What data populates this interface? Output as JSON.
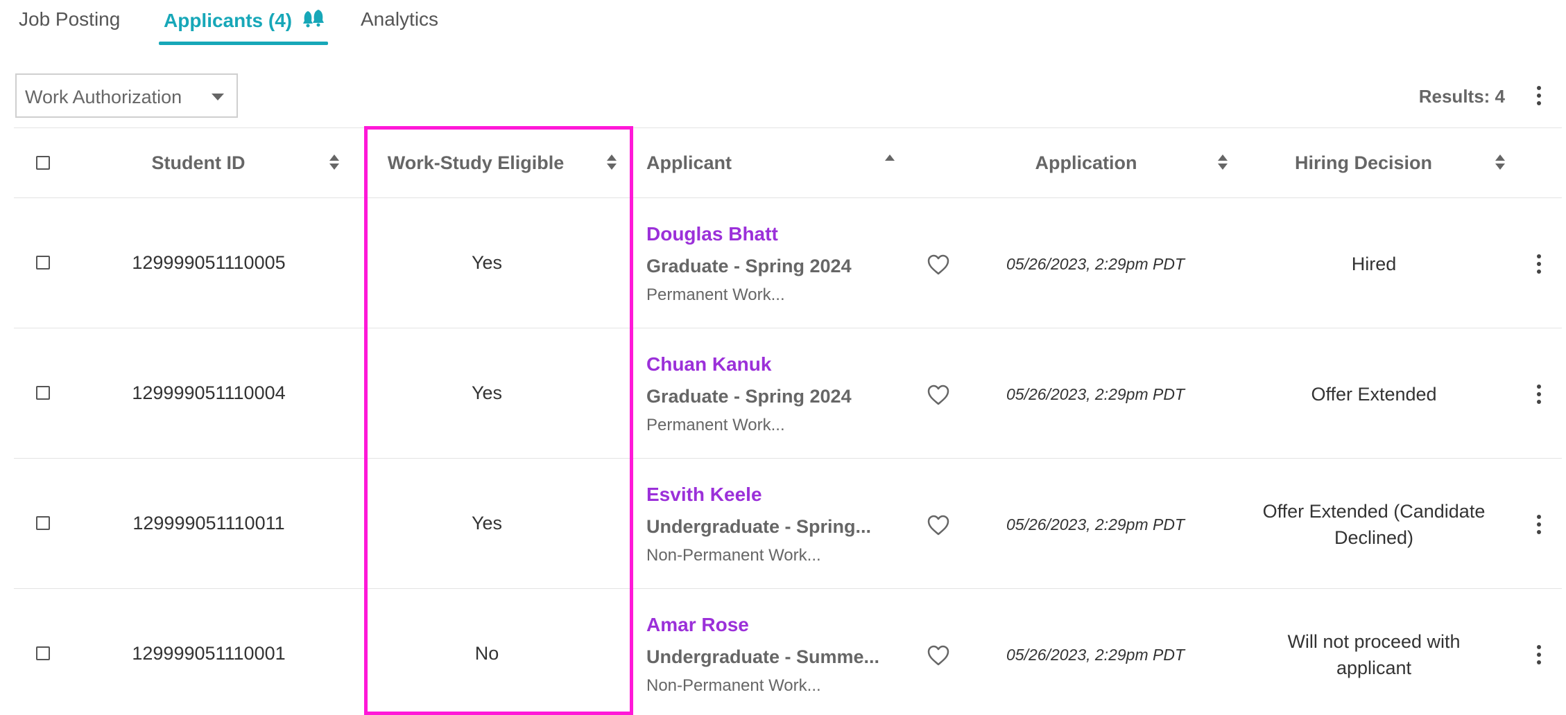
{
  "tabs": [
    {
      "label": "Job Posting"
    },
    {
      "label": "Applicants (4)"
    },
    {
      "label": "Analytics"
    }
  ],
  "filter": {
    "label": "Work Authorization"
  },
  "results": "Results: 4",
  "columns": {
    "student_id": "Student ID",
    "work_study": "Work-Study Eligible",
    "applicant": "Applicant",
    "application": "Application",
    "hiring_decision": "Hiring Decision"
  },
  "rows": [
    {
      "student_id": "129999051110005",
      "work_study": "Yes",
      "name": "Douglas Bhatt",
      "grad": "Graduate - Spring 2024",
      "auth": "Permanent Work...",
      "date": "05/26/2023, 2:29pm PDT",
      "decision": "Hired"
    },
    {
      "student_id": "129999051110004",
      "work_study": "Yes",
      "name": "Chuan Kanuk",
      "grad": "Graduate - Spring 2024",
      "auth": "Permanent Work...",
      "date": "05/26/2023, 2:29pm PDT",
      "decision": "Offer Extended"
    },
    {
      "student_id": "129999051110011",
      "work_study": "Yes",
      "name": "Esvith Keele",
      "grad": "Undergraduate - Spring...",
      "auth": "Non-Permanent Work...",
      "date": "05/26/2023, 2:29pm PDT",
      "decision": "Offer Extended (Candidate Declined)"
    },
    {
      "student_id": "129999051110001",
      "work_study": "No",
      "name": "Amar Rose",
      "grad": "Undergraduate - Summe...",
      "auth": "Non-Permanent Work...",
      "date": "05/26/2023, 2:29pm PDT",
      "decision": "Will not proceed with applicant"
    }
  ],
  "colors": {
    "accent": "#17a7b8",
    "applicant_name": "#9b30d9",
    "highlight": "#ff18d8"
  }
}
